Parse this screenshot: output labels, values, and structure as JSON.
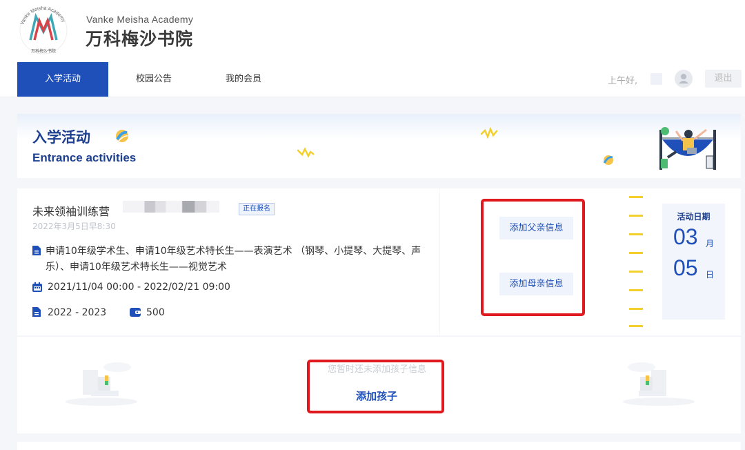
{
  "brand": {
    "name_en": "Vanke Meisha Academy",
    "name_zh": "万科梅沙书院",
    "seal_text_en": "Vanke Meisha Academy",
    "seal_text_zh": "万科梅沙书院",
    "seal_letters": "M",
    "colors": {
      "teal": "#3fa7b5",
      "red": "#d8434a"
    }
  },
  "nav": {
    "tabs": [
      {
        "label": "入学活动",
        "active": true
      },
      {
        "label": "校园公告",
        "active": false
      },
      {
        "label": "我的会员",
        "active": false
      }
    ],
    "greeting": "上午好,",
    "logout_label": "退出"
  },
  "banner": {
    "title": "入学活动",
    "subtitle": "Entrance activities"
  },
  "activity": {
    "title": "未来领袖训练营",
    "status_badge": "正在报名",
    "time_text": "2022年3月5日早8:30",
    "description": "申请10年级学术生、申请10年级艺术特长生——表演艺术 （钢琴、小提琴、大提琴、声乐）、申请10年级艺术特长生——视觉艺术",
    "date_range": "2021/11/04 00:00 - 2022/02/21 09:00",
    "school_year": "2022 - 2023",
    "price": "500",
    "add_father_label": "添加父亲信息",
    "add_mother_label": "添加母亲信息",
    "date_label": "活动日期",
    "month": "03",
    "month_unit": "月",
    "day": "05",
    "day_unit": "日"
  },
  "children": {
    "empty_text": "您暂时还未添加孩子信息",
    "add_label": "添加孩子"
  },
  "colors": {
    "primary": "#1f4fb8",
    "title_blue": "#1d3f8f",
    "highlight_red": "#e0191f",
    "tick_yellow": "#f2cf2a"
  },
  "icons": {
    "document": "document-icon",
    "calendar": "calendar-icon",
    "wallet": "wallet-icon",
    "user": "user-icon"
  }
}
